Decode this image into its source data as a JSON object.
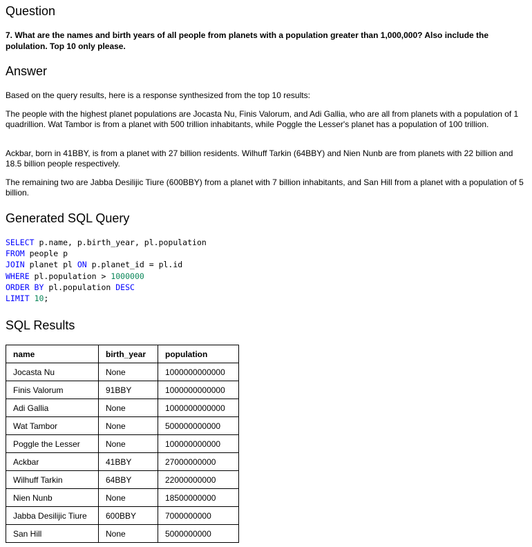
{
  "question": {
    "heading": "Question",
    "text": "7. What are the names and birth years of all people from planets with a population greater than 1,000,000? Also include the polulation. Top 10 only please."
  },
  "answer": {
    "heading": "Answer",
    "paragraphs": [
      "Based on the query results, here is a response synthesized from the top 10 results:",
      "The people with the highest planet populations are Jocasta Nu, Finis Valorum, and Adi Gallia, who are all from planets with a population of 1 quadrillion. Wat Tambor is from a planet with 500 trillion inhabitants, while Poggle the Lesser's planet has a population of 100 trillion.",
      "Ackbar, born in 41BBY, is from a planet with 27 billion residents. Wilhuff Tarkin (64BBY) and Nien Nunb are from planets with 22 billion and 18.5 billion people respectively.",
      "The remaining two are Jabba Desilijic Tiure (600BBY) from a planet with 7 billion inhabitants, and San Hill from a planet with a population of 5 billion."
    ]
  },
  "sql": {
    "heading": "Generated SQL Query",
    "lines": [
      [
        {
          "t": "SELECT",
          "c": "kw"
        },
        {
          "t": " p.name, p.birth_year, pl.population",
          "c": ""
        }
      ],
      [
        {
          "t": "FROM",
          "c": "kw"
        },
        {
          "t": " people p",
          "c": ""
        }
      ],
      [
        {
          "t": "JOIN",
          "c": "kw"
        },
        {
          "t": " planet pl ",
          "c": ""
        },
        {
          "t": "ON",
          "c": "kw"
        },
        {
          "t": " p.planet_id = pl.id",
          "c": ""
        }
      ],
      [
        {
          "t": "WHERE",
          "c": "kw"
        },
        {
          "t": " pl.population > ",
          "c": ""
        },
        {
          "t": "1000000",
          "c": "num"
        }
      ],
      [
        {
          "t": "ORDER BY",
          "c": "kw"
        },
        {
          "t": " pl.population ",
          "c": ""
        },
        {
          "t": "DESC",
          "c": "kw"
        }
      ],
      [
        {
          "t": "LIMIT",
          "c": "kw"
        },
        {
          "t": " ",
          "c": ""
        },
        {
          "t": "10",
          "c": "num"
        },
        {
          "t": ";",
          "c": ""
        }
      ]
    ],
    "colors": {
      "keyword": "#0000ff",
      "number": "#098658"
    }
  },
  "results": {
    "heading": "SQL Results",
    "columns": [
      "name",
      "birth_year",
      "population"
    ],
    "rows": [
      [
        "Jocasta Nu",
        "None",
        "1000000000000"
      ],
      [
        "Finis Valorum",
        "91BBY",
        "1000000000000"
      ],
      [
        "Adi Gallia",
        "None",
        "1000000000000"
      ],
      [
        "Wat Tambor",
        "None",
        "500000000000"
      ],
      [
        "Poggle the Lesser",
        "None",
        "100000000000"
      ],
      [
        "Ackbar",
        "41BBY",
        "27000000000"
      ],
      [
        "Wilhuff Tarkin",
        "64BBY",
        "22000000000"
      ],
      [
        "Nien Nunb",
        "None",
        "18500000000"
      ],
      [
        "Jabba Desilijic Tiure",
        "600BBY",
        "7000000000"
      ],
      [
        "San Hill",
        "None",
        "5000000000"
      ]
    ]
  }
}
